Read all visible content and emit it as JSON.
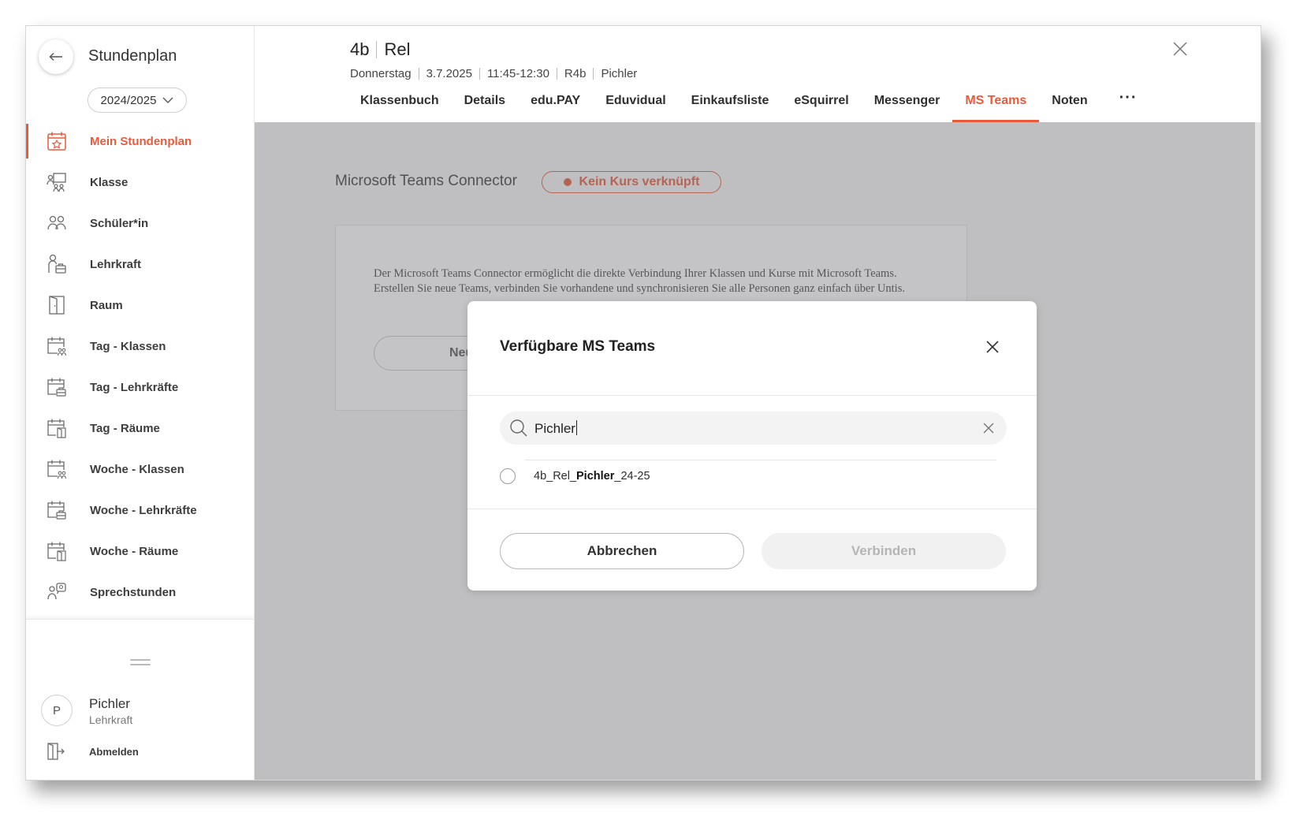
{
  "sidebar": {
    "back_icon": "arrow-left-icon",
    "app_title": "Stundenplan",
    "school_year": "2024/2025",
    "items": [
      {
        "label": "Mein Stundenplan",
        "icon": "calendar-star-icon",
        "active": true
      },
      {
        "label": "Klasse",
        "icon": "class-board-icon"
      },
      {
        "label": "Schüler*in",
        "icon": "students-icon"
      },
      {
        "label": "Lehrkraft",
        "icon": "teacher-icon"
      },
      {
        "label": "Raum",
        "icon": "door-icon"
      },
      {
        "label": "Tag - Klassen",
        "icon": "calendar-group-icon"
      },
      {
        "label": "Tag - Lehrkräfte",
        "icon": "calendar-briefcase-icon"
      },
      {
        "label": "Tag - Räume",
        "icon": "calendar-door-icon"
      },
      {
        "label": "Woche - Klassen",
        "icon": "calendar-group-icon"
      },
      {
        "label": "Woche - Lehrkräfte",
        "icon": "calendar-briefcase-icon"
      },
      {
        "label": "Woche - Räume",
        "icon": "calendar-door-icon"
      },
      {
        "label": "Sprechstunden",
        "icon": "consultation-icon"
      }
    ],
    "user": {
      "initial": "P",
      "name": "Pichler",
      "role": "Lehrkraft",
      "logout_label": "Abmelden"
    }
  },
  "header": {
    "class_name": "4b",
    "subject": "Rel",
    "meta": [
      "Donnerstag",
      "3.7.2025",
      "11:45-12:30",
      "R4b",
      "Pichler"
    ],
    "tabs": [
      "Klassenbuch",
      "Details",
      "edu.PAY",
      "Eduvidual",
      "Einkaufsliste",
      "eSquirrel",
      "Messenger",
      "MS Teams",
      "Noten"
    ],
    "active_tab": "MS Teams",
    "more_label": "···"
  },
  "page": {
    "connector_title": "Microsoft Teams Connector",
    "status_text": "Kein Kurs verknüpft",
    "description": "Der Microsoft Teams Connector ermöglicht die direkte Verbindung Ihrer Klassen und Kurse mit Microsoft Teams. Erstellen Sie neue Teams, verbinden Sie vorhandene und synchronisieren Sie alle Personen ganz einfach über Untis.",
    "new_button_label": "Neues"
  },
  "modal": {
    "title": "Verfügbare MS Teams",
    "search_value": "Pichler",
    "results": [
      {
        "prefix": "4b_Rel_",
        "match": "Pichler",
        "suffix": "_24-25",
        "selected": false
      }
    ],
    "cancel_label": "Abbrechen",
    "connect_label": "Verbinden"
  },
  "colors": {
    "accent": "#e65b3b",
    "overlay": "#8f8f92",
    "disabled_text": "#b5b5b5"
  }
}
